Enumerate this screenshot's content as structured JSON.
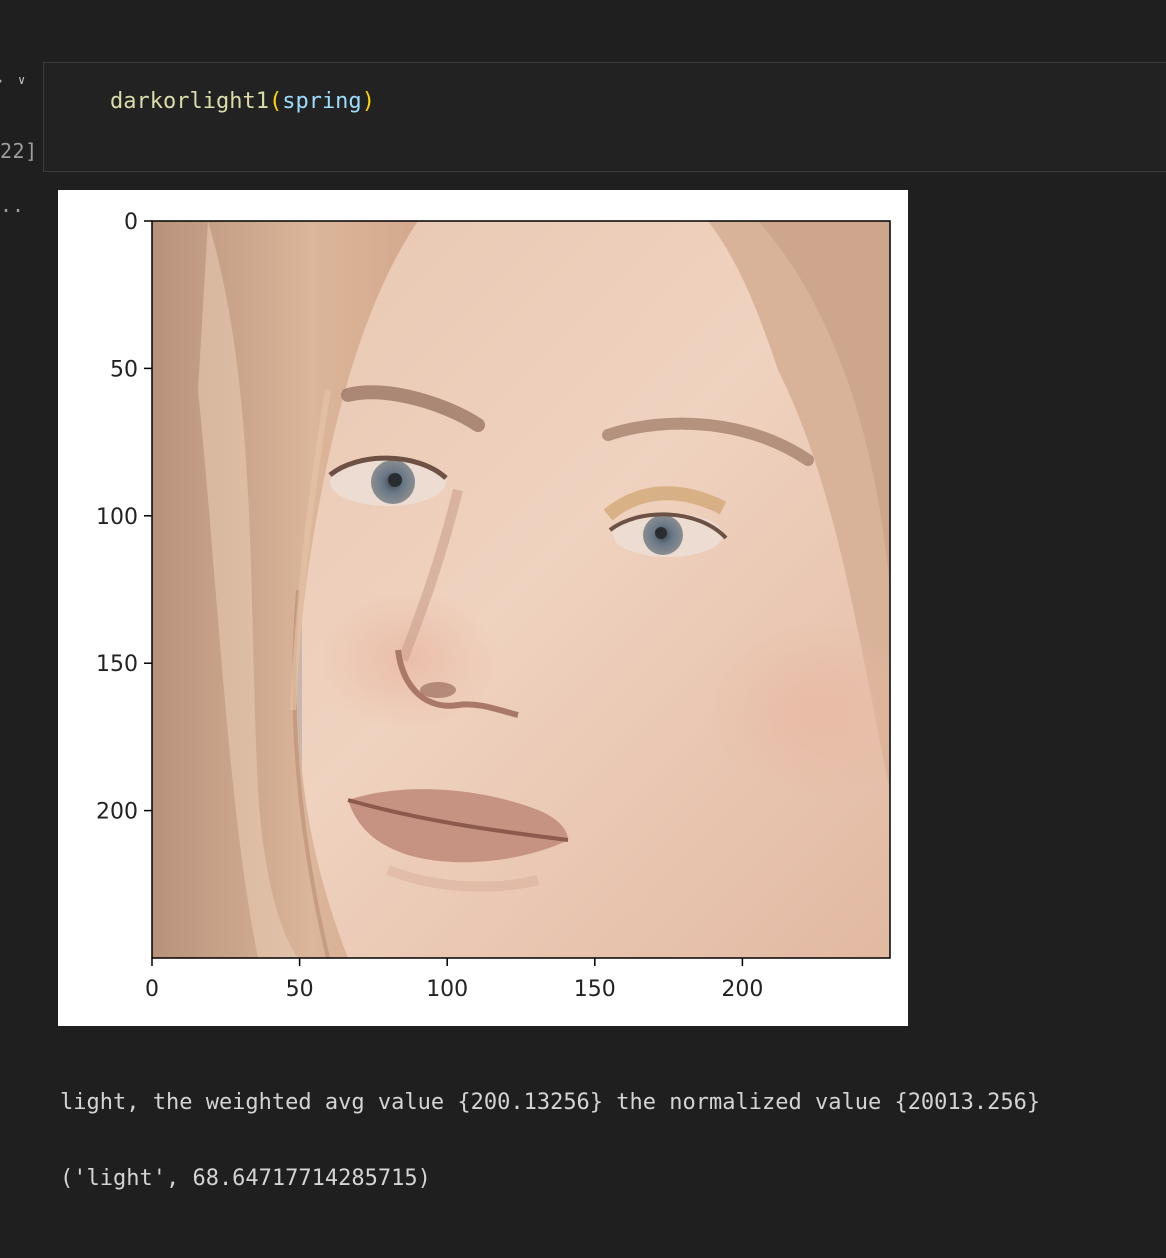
{
  "cell": {
    "execution_count": "22]",
    "code": {
      "function_name": "darkorlight1",
      "open_paren": "(",
      "argument": "spring",
      "close_paren": ")"
    },
    "output_ellipsis": ".."
  },
  "plot": {
    "image_subject": "close-up portrait of a woman's face",
    "y_ticks": [
      "0",
      "50",
      "100",
      "150",
      "200"
    ],
    "x_ticks": [
      "0",
      "50",
      "100",
      "150",
      "200"
    ],
    "xlim": [
      0,
      250
    ],
    "ylim": [
      0,
      250
    ]
  },
  "output": {
    "line1": "light, the weighted avg value {200.13256} the normalized value {20013.256}",
    "line2": "('light', 68.64717714285715)"
  },
  "colors": {
    "background": "#1f1f1f",
    "function": "#dcdcaa",
    "bracket": "#ffd700",
    "variable": "#9cdcfe",
    "output_text": "#d4d4d4"
  }
}
